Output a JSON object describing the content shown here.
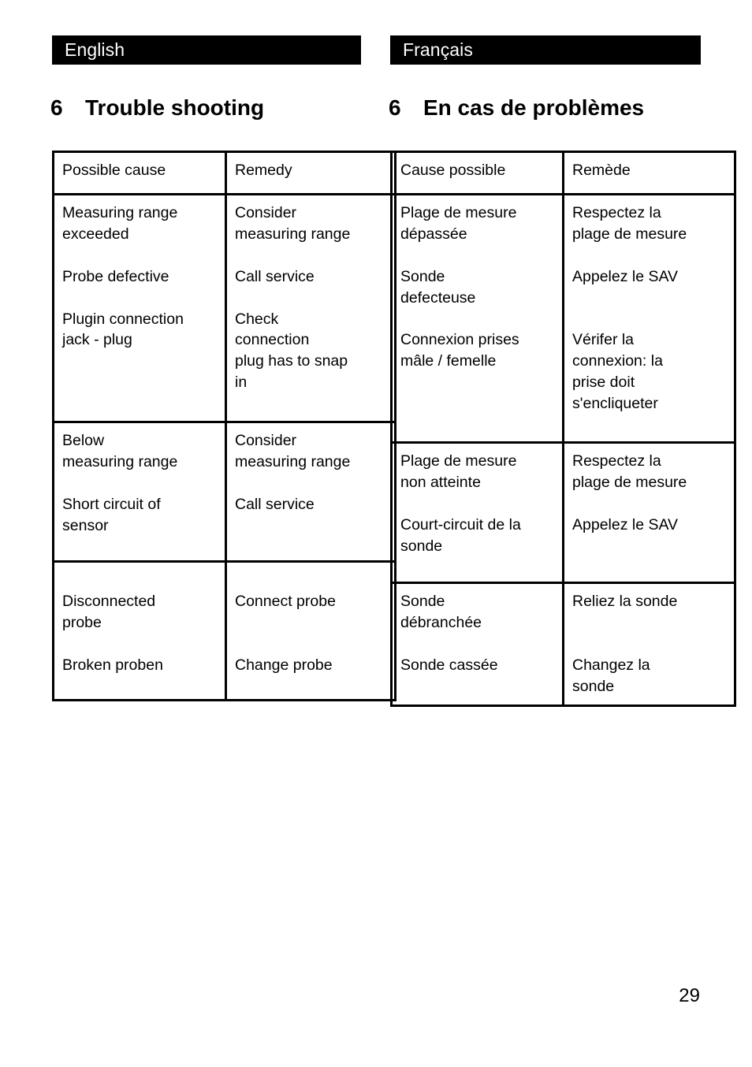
{
  "page": {
    "number": "29"
  },
  "columns": {
    "english": {
      "lang_label": "English",
      "heading": {
        "number": "6",
        "title": "Trouble shooting"
      },
      "table": {
        "headers": {
          "cause": "Possible cause",
          "remedy": "Remedy"
        },
        "rows": [
          {
            "cause_lines": [
              "Measuring range",
              "exceeded",
              "Probe defective",
              "Plugin connection",
              "jack - plug"
            ],
            "remedy_lines": [
              "Consider",
              "measuring range",
              "Call service",
              "Check",
              "connection",
              "plug has to snap",
              "in"
            ]
          },
          {
            "cause_lines": [
              "Below",
              "measuring range",
              "Short circuit of",
              "sensor"
            ],
            "remedy_lines": [
              "Consider",
              "measuring range",
              "Call service"
            ]
          },
          {
            "cause_lines": [
              "Disconnected",
              "probe",
              "Broken proben"
            ],
            "remedy_lines": [
              "Connect probe",
              "Change probe"
            ]
          }
        ]
      }
    },
    "french": {
      "lang_label": "Français",
      "heading": {
        "number": "6",
        "title": "En cas de problèmes"
      },
      "table": {
        "headers": {
          "cause": "Cause possible",
          "remedy": "Remède"
        },
        "rows": [
          {
            "cause_lines": [
              "Plage de mesure",
              "dépassée",
              "Sonde",
              "defecteuse",
              "Connexion prises",
              "mâle / femelle"
            ],
            "remedy_lines": [
              "Respectez la",
              "plage de mesure",
              "Appelez le SAV",
              "Vérifer la",
              "connexion: la",
              "prise doit",
              "s'encliqueter"
            ]
          },
          {
            "cause_lines": [
              "Plage de mesure",
              "non atteinte",
              "Court-circuit de la",
              "sonde"
            ],
            "remedy_lines": [
              "Respectez la",
              "plage de mesure",
              "Appelez le SAV"
            ]
          },
          {
            "cause_lines": [
              "Sonde",
              "débranchée",
              "Sonde cassée"
            ],
            "remedy_lines": [
              "Reliez la sonde",
              "Changez la",
              "sonde"
            ]
          }
        ]
      }
    }
  }
}
